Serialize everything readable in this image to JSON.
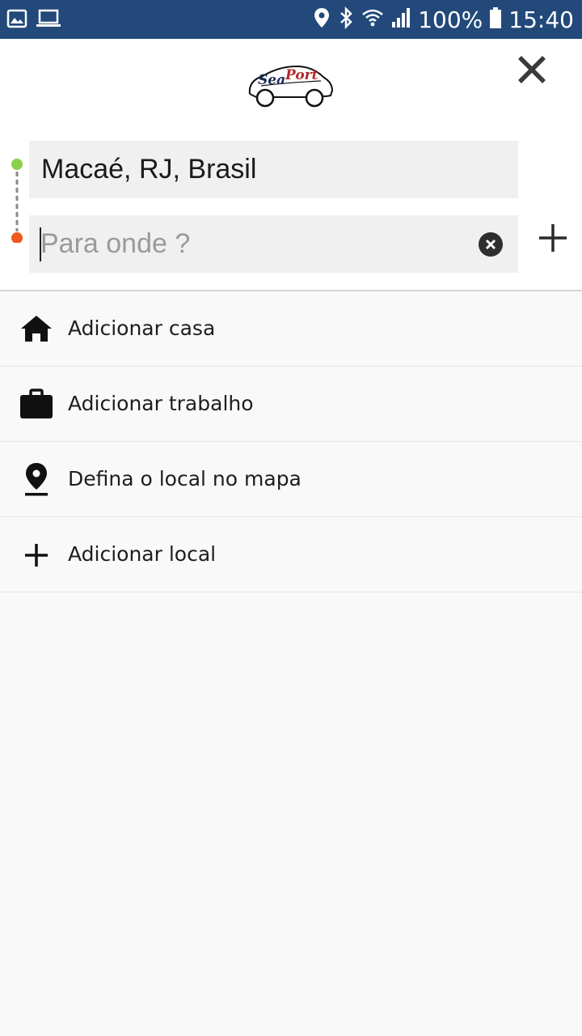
{
  "status_bar": {
    "battery": "100%",
    "time": "15:40",
    "left_icons": [
      "gallery-icon",
      "laptop-icon"
    ],
    "right_icons": [
      "location-icon",
      "bluetooth-icon",
      "wifi-icon",
      "signal-icon",
      "battery-icon"
    ]
  },
  "header": {
    "logo_text": "SeaPort",
    "close_icon": "close-icon"
  },
  "route": {
    "origin_value": "Macaé, RJ, Brasil",
    "destination_value": "",
    "destination_placeholder": "Para onde ?",
    "origin_color": "#8bd04c",
    "destination_color": "#f05a22"
  },
  "list": {
    "items": [
      {
        "label": "Adicionar casa",
        "icon": "home-icon"
      },
      {
        "label": "Adicionar trabalho",
        "icon": "briefcase-icon"
      },
      {
        "label": "Defina o local no mapa",
        "icon": "map-pin-icon"
      },
      {
        "label": "Adicionar local",
        "icon": "plus-icon"
      }
    ]
  },
  "colors": {
    "status_bar": "#22497a",
    "field_bg": "#f0f0f0",
    "page_bg": "#f9f9f9"
  }
}
